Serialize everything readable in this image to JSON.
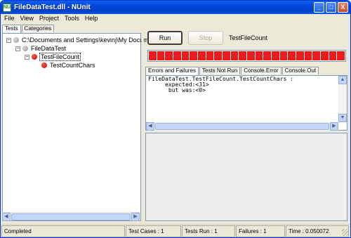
{
  "window": {
    "title": "FileDataTest.dll - NUnit",
    "icon_text": "NU",
    "min_label": "_",
    "max_label": "□",
    "close_label": "X"
  },
  "menu": [
    "File",
    "View",
    "Project",
    "Tools",
    "Help"
  ],
  "left_tabs": [
    "Tests",
    "Categories"
  ],
  "tree": [
    {
      "label": "C:\\Documents and Settings\\kevinj\\My Docume",
      "status": "grey",
      "expander": "−"
    },
    {
      "label": "FileDataTest",
      "status": "grey",
      "expander": "−"
    },
    {
      "label": "TestFileCount",
      "status": "red",
      "expander": "−"
    },
    {
      "label": "TestCountChars",
      "status": "red",
      "expander": ""
    }
  ],
  "run_panel": {
    "run_label": "Run",
    "stop_label": "Stop",
    "current_test": "TestFileCount",
    "progress_fraction": 1.0,
    "progress_color": "#ec1c1c"
  },
  "result_tabs": [
    "Errors and Failures",
    "Tests Not Run",
    "Console.Error",
    "Console.Out"
  ],
  "error_text": "FileDataTest.TestFileCount.TestCountChars :\n     expected:<31>\n      but was:<0>",
  "status": {
    "message": "Completed",
    "test_cases": "Test Cases : 1",
    "tests_run": "Tests Run : 1",
    "failures": "Failures : 1",
    "time": "Time : 0.050072"
  }
}
